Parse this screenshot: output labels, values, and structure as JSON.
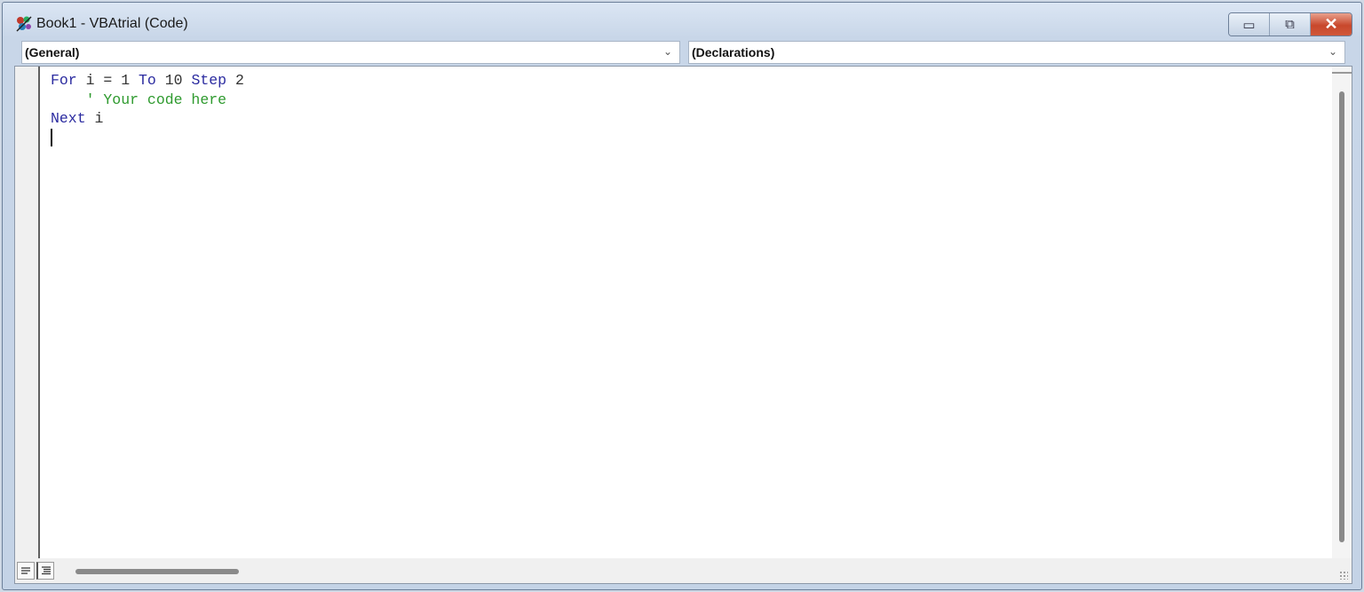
{
  "window": {
    "title": "Book1 - VBAtrial (Code)",
    "minimize_glyph": "▭",
    "maximize_glyph": "⧉",
    "close_glyph": "✕"
  },
  "combos": {
    "object": "(General)",
    "procedure": "(Declarations)"
  },
  "code": {
    "line1": {
      "kw1": "For",
      "t1": " i = 1 ",
      "kw2": "To",
      "t2": " 10 ",
      "kw3": "Step",
      "t3": " 2"
    },
    "line2": {
      "comment": "    ' Your code here"
    },
    "line3": {
      "kw1": "Next",
      "t1": " i"
    }
  },
  "colors": {
    "keyword": "#2b2ba0",
    "comment": "#2e9a2e",
    "close_button": "#c8482c"
  },
  "icons": {
    "app": "vba-project-icon",
    "chevron": "chevron-down-icon",
    "procedure_view": "procedure-view-icon",
    "full_module_view": "full-module-view-icon"
  }
}
